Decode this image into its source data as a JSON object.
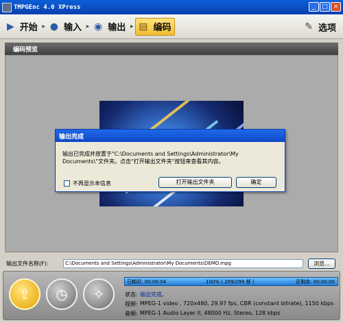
{
  "window": {
    "title": "TMPGEnc 4.0 XPress"
  },
  "toolbar": {
    "start": "开始",
    "input": "输入",
    "output": "输出",
    "encode": "编码",
    "options": "选项"
  },
  "section": {
    "title": "编码预览"
  },
  "dialog": {
    "title": "输出完成",
    "message": "输出已完成并放置于\"C:\\Documents and Settings\\Administrator\\My Documents\\\"文件夹。点击\"打开输出文件夹\"按钮来查看其内容。",
    "checkbox_label": "不再显示本信息",
    "open_folder_button": "打开输出文件夹",
    "ok_button": "确定"
  },
  "output_file": {
    "label": "输出文件名称(F):",
    "value": "C:\\Documents and Settings\\Administrator\\My Documents\\DEMO.mpg",
    "browse_button": "浏览..."
  },
  "progress": {
    "elapsed": "已耗时: 00:00:04",
    "percent_text": "100% ( 299/299 帧 )",
    "remaining": "还剩余: 00:00:00",
    "value": 1.0
  },
  "info": {
    "status_key": "状态:",
    "status_value": "输出完成。",
    "video_key": "视频:",
    "video_value": "MPEG-1 video , 720x480, 29.97 fps, CBR (constant bitrate), 1150 kbps",
    "audio_key": "音频:",
    "audio_value": "MPEG-1 Audio Layer II, 48000 Hz, Stereo, 128 kbps"
  },
  "colors": {
    "accent": "#f4bd32",
    "title_blue": "#0a5fd8"
  }
}
